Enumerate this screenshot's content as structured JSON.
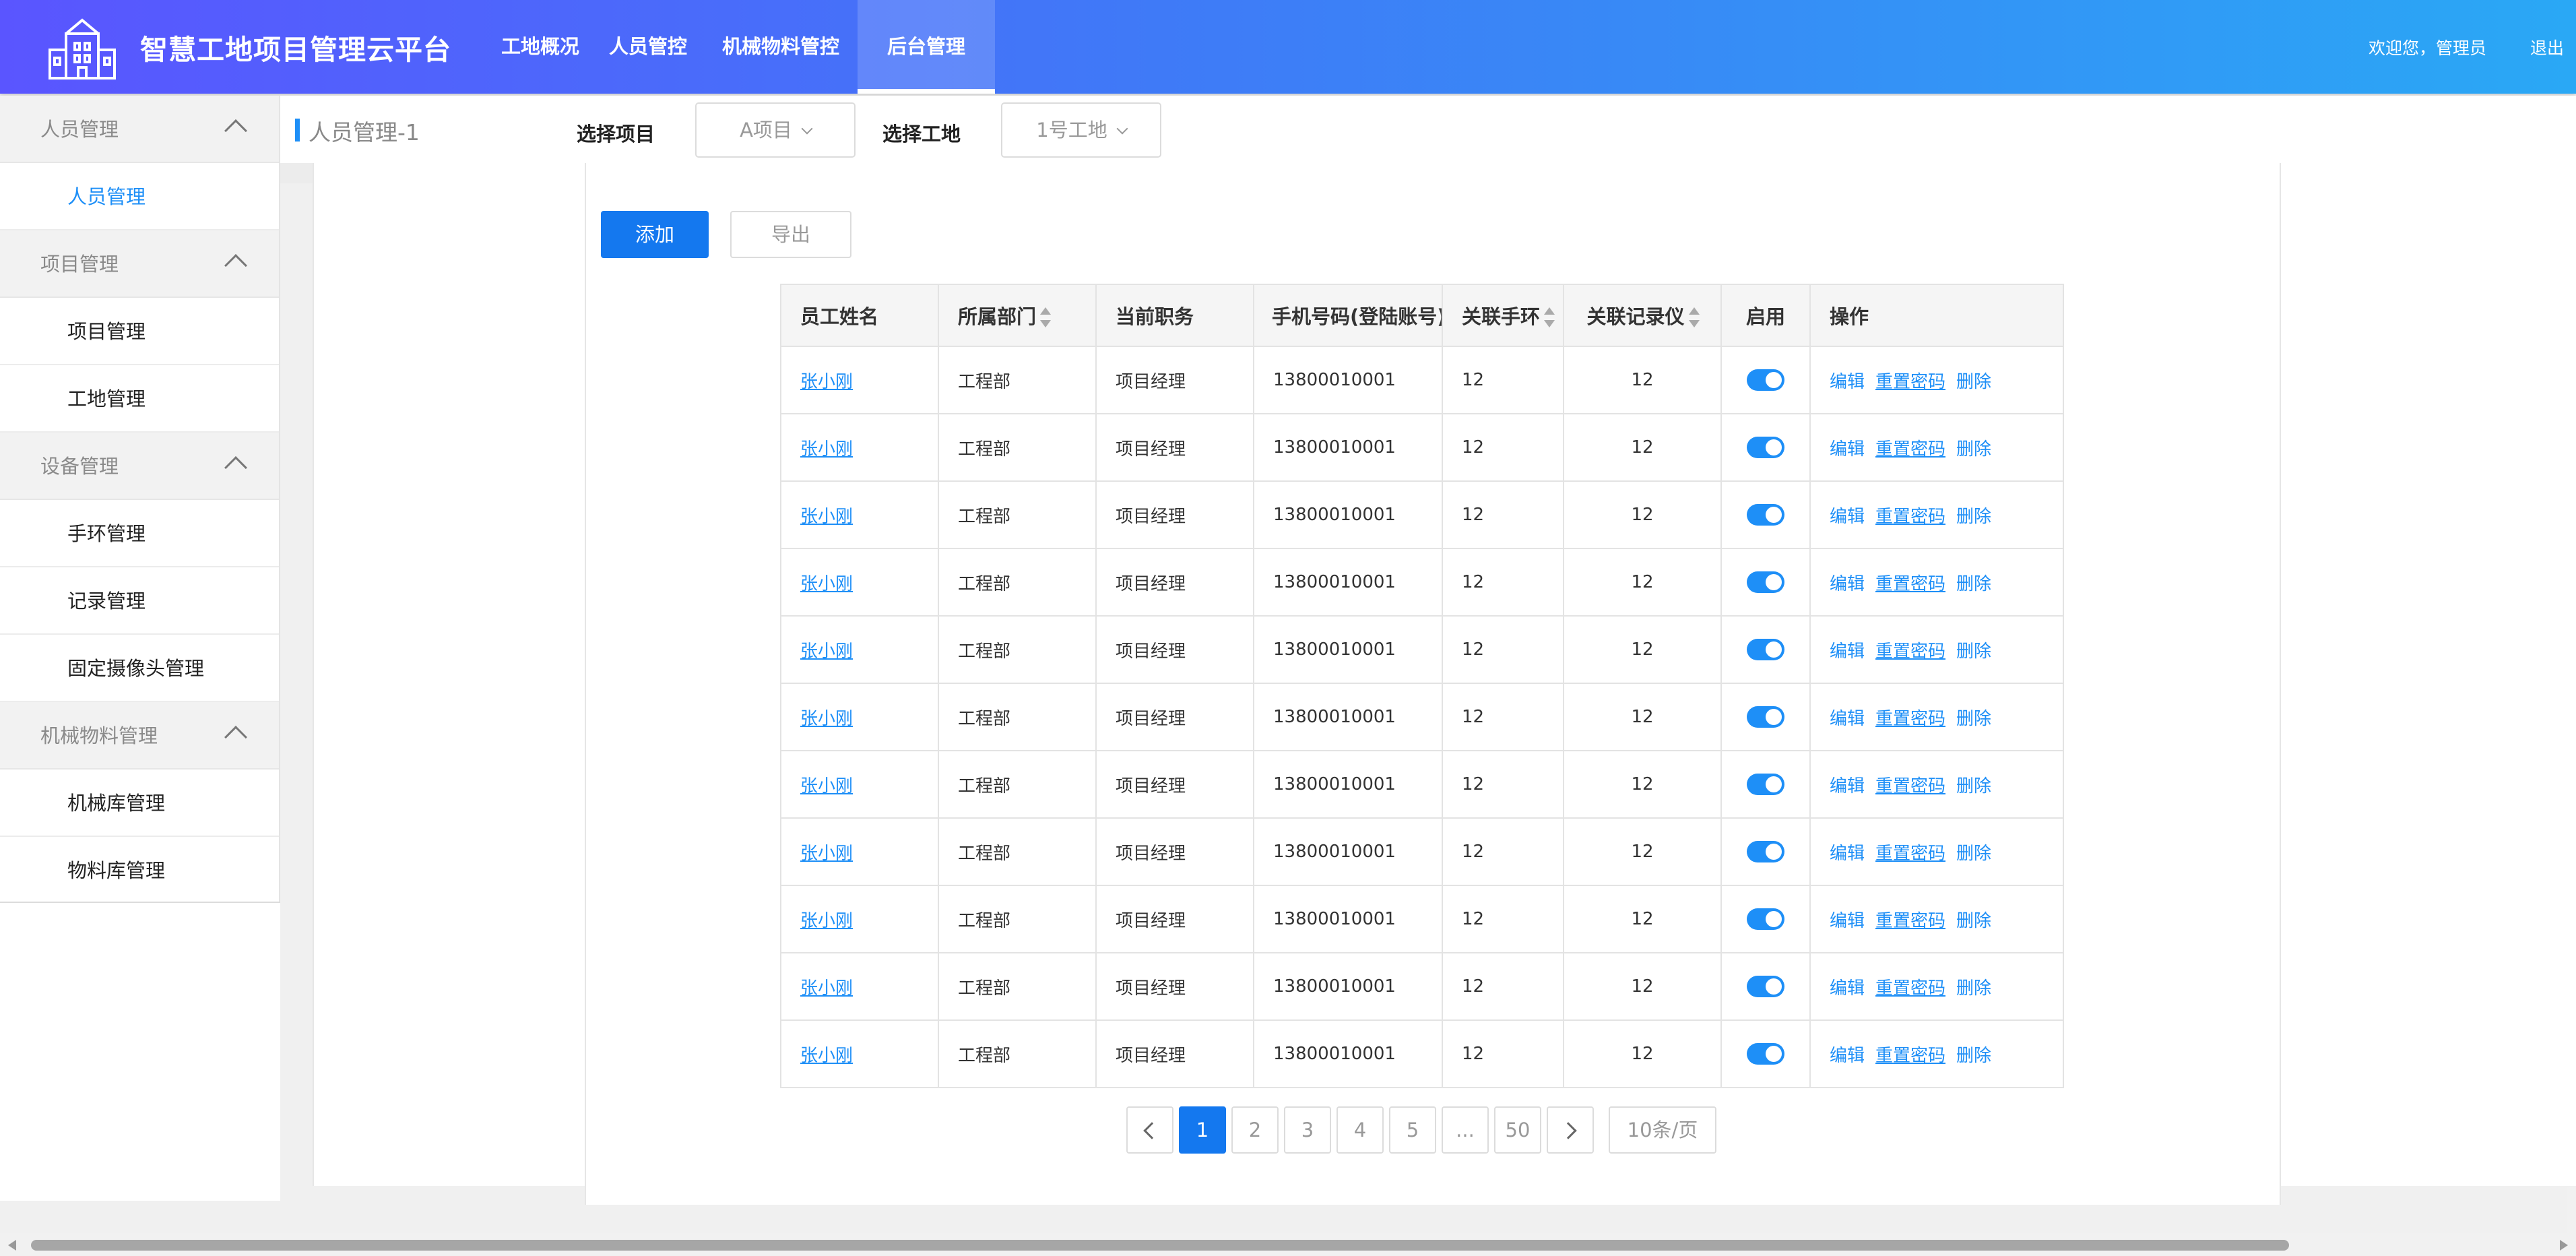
{
  "header": {
    "brand": "智慧工地项目管理云平台",
    "nav": [
      "工地概况",
      "人员管控",
      "机械物料管控",
      "后台管理"
    ],
    "active_nav": "后台管理",
    "welcome": "欢迎您，管理员",
    "logout": "退出"
  },
  "sidebar": {
    "groups": [
      {
        "label": "人员管理",
        "items": [
          "人员管理"
        ]
      },
      {
        "label": "项目管理",
        "items": [
          "项目管理",
          "工地管理"
        ]
      },
      {
        "label": "设备管理",
        "items": [
          "手环管理",
          "记录管理",
          "固定摄像头管理"
        ]
      },
      {
        "label": "机械物料管理",
        "items": [
          "机械库管理",
          "物料库管理"
        ]
      }
    ],
    "active_item": "人员管理"
  },
  "breadcrumb": "人员管理-1",
  "filters": {
    "project_label": "选择项目",
    "project_value": "A项目",
    "site_label": "选择工地",
    "site_value": "1号工地"
  },
  "actions": {
    "add": "添加",
    "export": "导出"
  },
  "table": {
    "headers": [
      "员工姓名",
      "所属部门",
      "当前职务",
      "手机号码(登陆账号)",
      "关联手环",
      "关联记录仪",
      "启用",
      "操作"
    ],
    "rows": [
      {
        "name": "张小刚",
        "dept": "工程部",
        "role": "项目经理",
        "phone": "13800010001",
        "band": "12",
        "recorder": "12",
        "enabled": true
      },
      {
        "name": "张小刚",
        "dept": "工程部",
        "role": "项目经理",
        "phone": "13800010001",
        "band": "12",
        "recorder": "12",
        "enabled": true
      },
      {
        "name": "张小刚",
        "dept": "工程部",
        "role": "项目经理",
        "phone": "13800010001",
        "band": "12",
        "recorder": "12",
        "enabled": true
      },
      {
        "name": "张小刚",
        "dept": "工程部",
        "role": "项目经理",
        "phone": "13800010001",
        "band": "12",
        "recorder": "12",
        "enabled": true
      },
      {
        "name": "张小刚",
        "dept": "工程部",
        "role": "项目经理",
        "phone": "13800010001",
        "band": "12",
        "recorder": "12",
        "enabled": true
      },
      {
        "name": "张小刚",
        "dept": "工程部",
        "role": "项目经理",
        "phone": "13800010001",
        "band": "12",
        "recorder": "12",
        "enabled": true
      },
      {
        "name": "张小刚",
        "dept": "工程部",
        "role": "项目经理",
        "phone": "13800010001",
        "band": "12",
        "recorder": "12",
        "enabled": true
      },
      {
        "name": "张小刚",
        "dept": "工程部",
        "role": "项目经理",
        "phone": "13800010001",
        "band": "12",
        "recorder": "12",
        "enabled": true
      },
      {
        "name": "张小刚",
        "dept": "工程部",
        "role": "项目经理",
        "phone": "13800010001",
        "band": "12",
        "recorder": "12",
        "enabled": true
      },
      {
        "name": "张小刚",
        "dept": "工程部",
        "role": "项目经理",
        "phone": "13800010001",
        "band": "12",
        "recorder": "12",
        "enabled": true
      },
      {
        "name": "张小刚",
        "dept": "工程部",
        "role": "项目经理",
        "phone": "13800010001",
        "band": "12",
        "recorder": "12",
        "enabled": true
      }
    ],
    "operations": [
      "编辑",
      "重置密码",
      "删除"
    ]
  },
  "pagination": {
    "pages": [
      "1",
      "2",
      "3",
      "4",
      "5",
      "...",
      "50"
    ],
    "current": "1",
    "page_size": "10条/页"
  },
  "colors": {
    "primary": "#1478ef",
    "link": "#1e8ff7",
    "header_start": "#5a55ff",
    "header_end": "#2aa8f5"
  }
}
